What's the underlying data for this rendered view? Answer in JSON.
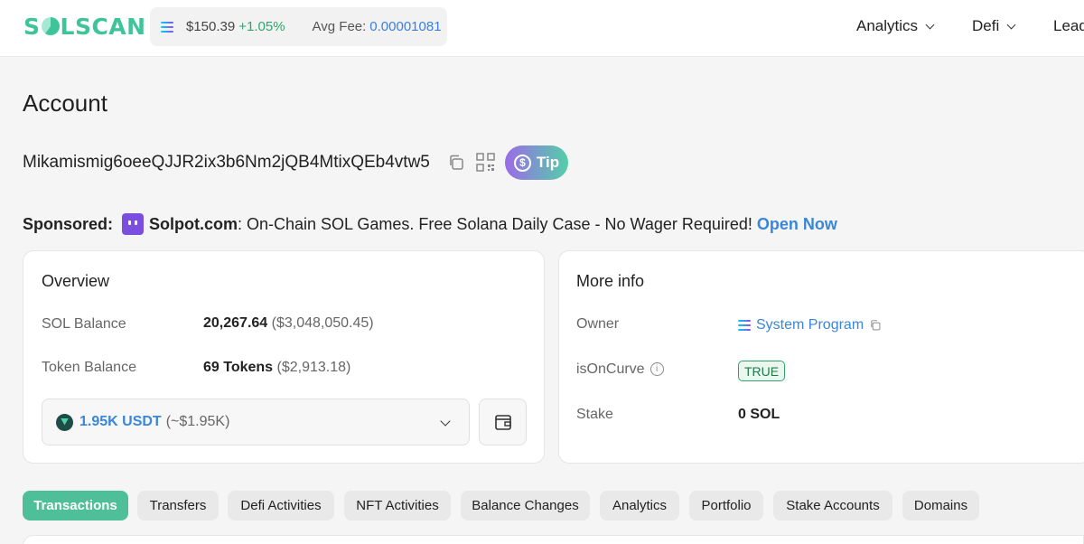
{
  "header": {
    "logo": {
      "before": "S",
      "after": "LSCAN"
    },
    "price": "$150.39",
    "change": "+1.05%",
    "fee_label": "Avg Fee:",
    "fee_value": "0.00001081",
    "nav": [
      "Analytics",
      "Defi",
      "Lead"
    ]
  },
  "account": {
    "title": "Account",
    "address": "Mikamismig6oeeQJJR2ix3b6Nm2jQB4MtixQEb4vtw5",
    "tip_label": "Tip",
    "tip_coin": "$"
  },
  "sponsored": {
    "label": "Sponsored:",
    "site": "Solpot.com",
    "text": ": On-Chain SOL Games. Free Solana Daily Case - No Wager Required!",
    "link": "Open Now"
  },
  "overview": {
    "title": "Overview",
    "sol_label": "SOL Balance",
    "sol_value": "20,267.64",
    "sol_usd": "($3,048,050.45)",
    "token_label": "Token Balance",
    "token_value": "69 Tokens",
    "token_usd": "($2,913.18)",
    "selected_token": "1.95K USDT",
    "selected_token_usd": "(~$1.95K)"
  },
  "more_info": {
    "title": "More info",
    "owner_label": "Owner",
    "owner_value": "System Program",
    "curve_label": "isOnCurve",
    "curve_value": "TRUE",
    "stake_label": "Stake",
    "stake_value": "0 SOL"
  },
  "tabs": [
    {
      "label": "Transactions",
      "active": true
    },
    {
      "label": "Transfers"
    },
    {
      "label": "Defi Activities"
    },
    {
      "label": "NFT Activities"
    },
    {
      "label": "Balance Changes"
    },
    {
      "label": "Analytics"
    },
    {
      "label": "Portfolio"
    },
    {
      "label": "Stake Accounts"
    },
    {
      "label": "Domains"
    }
  ],
  "colors": {
    "brand": "#3fc49a",
    "link": "#3a86d8",
    "positive": "#30a46c",
    "tab_active": "#4fbf99"
  },
  "icons": [
    "solana-icon",
    "copy-icon",
    "qr-code-icon",
    "dollar-coin-icon",
    "usdt-icon",
    "chevron-down-icon",
    "wallet-icon",
    "info-icon"
  ]
}
